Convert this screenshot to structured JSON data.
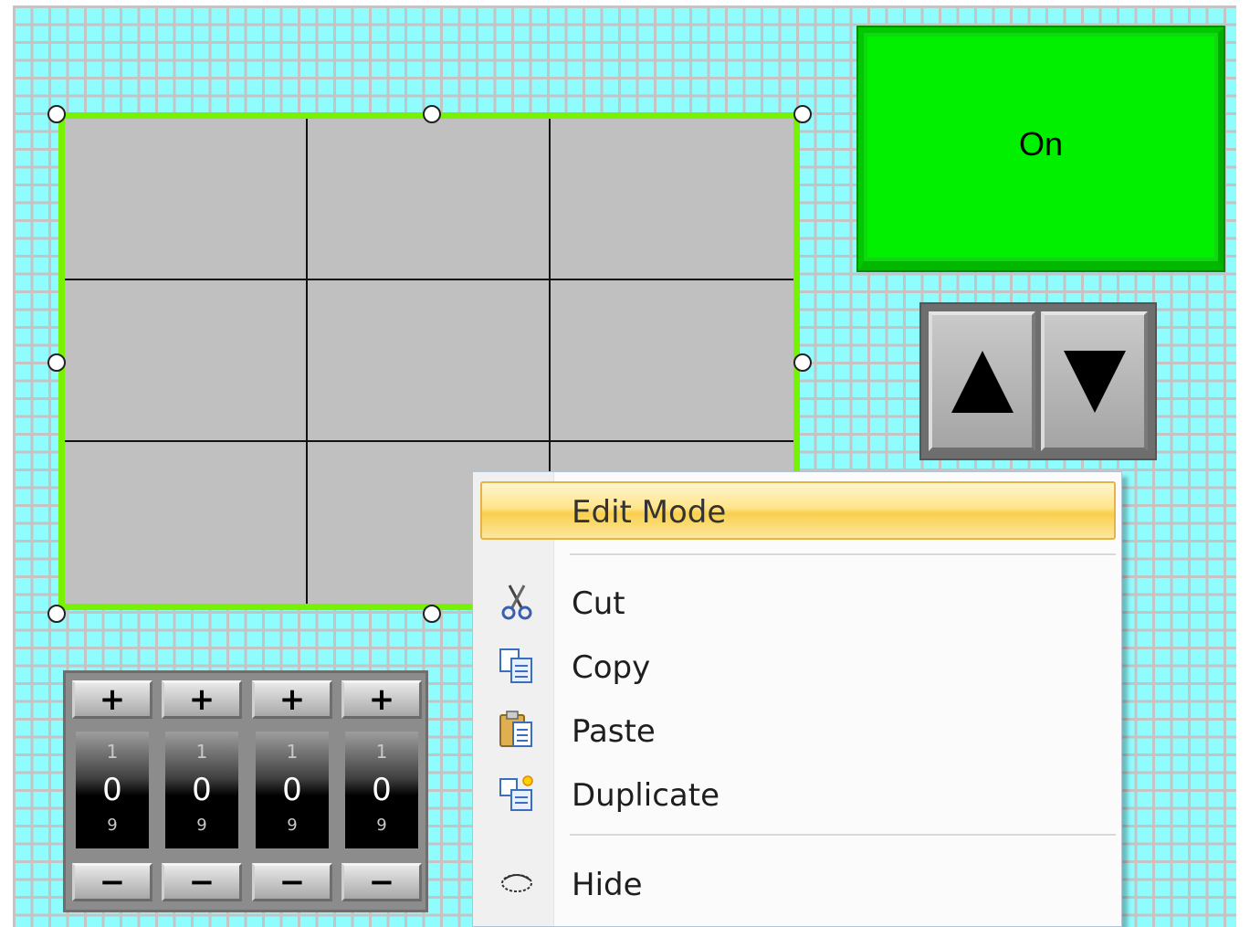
{
  "on_button": {
    "label": "On",
    "color": "#00f000"
  },
  "counter": {
    "digits": [
      {
        "prev": "1",
        "value": "0",
        "next": "9"
      },
      {
        "prev": "1",
        "value": "0",
        "next": "9"
      },
      {
        "prev": "1",
        "value": "0",
        "next": "9"
      },
      {
        "prev": "1",
        "value": "0",
        "next": "9"
      }
    ],
    "plus_symbol": "+",
    "minus_symbol": "−"
  },
  "context_menu": {
    "items": [
      {
        "label": "Edit Mode",
        "icon": ""
      },
      {
        "label": "Cut",
        "icon": "scissors-icon"
      },
      {
        "label": "Copy",
        "icon": "copy-icon"
      },
      {
        "label": "Paste",
        "icon": "paste-icon"
      },
      {
        "label": "Duplicate",
        "icon": "duplicate-icon"
      },
      {
        "label": "Hide",
        "icon": "hide-icon"
      }
    ],
    "highlight_color": "#f9cf4e"
  },
  "selection_color": "#77f104",
  "canvas_color": "#8ffcfe"
}
